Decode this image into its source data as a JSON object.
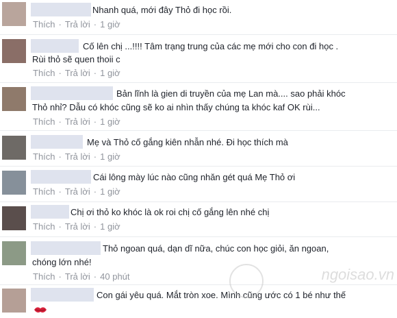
{
  "colors": {
    "link": "#90949c",
    "text": "#1d2129",
    "name_block": "#dfe3ee",
    "divider": "#e9ebee"
  },
  "actions": {
    "like": "Thích",
    "reply": "Trả lời",
    "separator": "·"
  },
  "comments": [
    {
      "text": "Nhanh quá, mới đây Thỏ đi học rồi.",
      "time": "1 giờ",
      "avatar_color": "#b9a59c"
    },
    {
      "text": "Cố lên chị ...!!!! Tâm trạng trung của các mẹ mới cho con đi học .",
      "text2": "Rùi thỏ sẽ quen thoii c",
      "time": "1 giờ",
      "avatar_color": "#8a6e67"
    },
    {
      "text": "Bản lĩnh là gien di truyền của mẹ Lan mà.... sao phải khóc",
      "text2": "Thỏ nhỉ? Dẫu có khóc cũng sẽ ko ai nhìn thấy chúng ta khóc kaf OK rùi...",
      "time": "1 giờ",
      "avatar_color": "#8f7a6b"
    },
    {
      "text": "Mẹ và Thỏ cố gắng kiên nhẫn nhé. Đi học thích mà",
      "time": "1 giờ",
      "avatar_color": "#6e6a66"
    },
    {
      "text": "Cái lông mày lúc nào cũng nhăn gét quá Mẹ Thỏ ơi",
      "time": "1 giờ",
      "avatar_color": "#86909a"
    },
    {
      "text": "Chị ơi thỏ ko khóc là ok roi chị cố gắng lên nhé chị",
      "time": "1 giờ",
      "avatar_color": "#5a4e4c"
    },
    {
      "text": "Thỏ ngoan quá, dạn dĩ nữa, chúc con học giỏi, ăn ngoan,",
      "text2": "chóng lớn nhé!",
      "time": "40 phút",
      "avatar_color": "#8c9a86"
    },
    {
      "text": "Con gái yêu quá. Mắt tròn xoe. Mình cũng ước có 1 bé như thế",
      "avatar_color": "#b59f96"
    }
  ],
  "watermark": "ngoisao.vn"
}
